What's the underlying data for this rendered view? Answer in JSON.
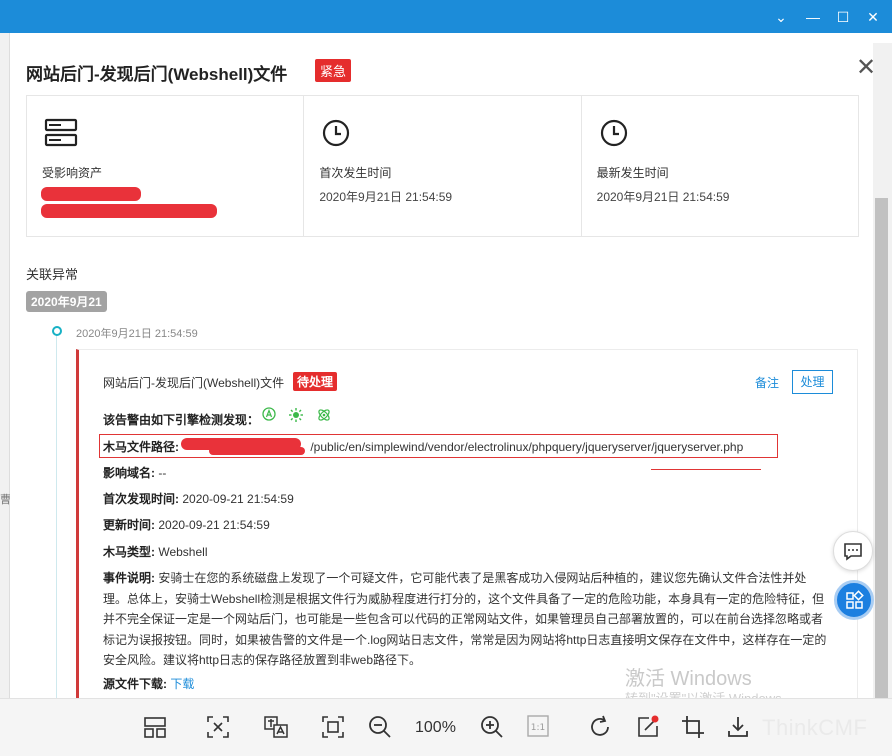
{
  "dialog": {
    "title": "网站后门-发现后门(Webshell)文件",
    "urgency": "紧急"
  },
  "cards": [
    {
      "label": "受影响资产",
      "value": ""
    },
    {
      "label": "首次发生时间",
      "value": "2020年9月21日 21:54:59"
    },
    {
      "label": "最新发生时间",
      "value": "2020年9月21日 21:54:59"
    }
  ],
  "timeline": {
    "section": "关联异常",
    "date": "2020年9月21",
    "time": "2020年9月21日 21:54:59"
  },
  "event": {
    "title": "网站后门-发现后门(Webshell)文件",
    "status": "待处理",
    "note": "备注",
    "process": "处理",
    "engines_label": "该告警由如下引擎检测发现：",
    "path_label": "木马文件路径:",
    "path_value": "/public/en/simplewind/vendor/electrolinux/phpquery/jqueryserver/jqueryserver.php",
    "domain_label": "影响域名:",
    "domain_value": "--",
    "first_label": "首次发现时间:",
    "first_value": "2020-09-21 21:54:59",
    "update_label": "更新时间:",
    "update_value": "2020-09-21 21:54:59",
    "type_label": "木马类型:",
    "type_value": "Webshell",
    "desc_label": "事件说明:",
    "desc_text": "安骑士在您的系统磁盘上发现了一个可疑文件，它可能代表了是黑客成功入侵网站后种植的，建议您先确认文件合法性并处理。总体上，安骑士Webshell检测是根据文件行为威胁程度进行打分的，这个文件具备了一定的危险功能，本身具有一定的危险特征，但并不完全保证一定是一个网站后门，也可能是一些包含可以代码的正常网站文件，如果管理员自己部署放置的，可以在前台选择忽略或者标记为误报按钮。同时，如果被告警的文件是一个.log网站日志文件，常常是因为网站将http日志直接明文保存在文件中，这样存在一定的安全风险。建议将http日志的保存路径放置到非web路径下。",
    "download_label": "源文件下载:",
    "download_link": "下载"
  },
  "watermark": {
    "line1": "激活 Windows",
    "line2": "转到\"设置\"以激活 Windows。"
  },
  "toolbar": {
    "zoom": "100%",
    "brand": "ThinkCMF"
  },
  "colors": {
    "accent": "#1c8cd9",
    "danger": "#e52d2d"
  }
}
